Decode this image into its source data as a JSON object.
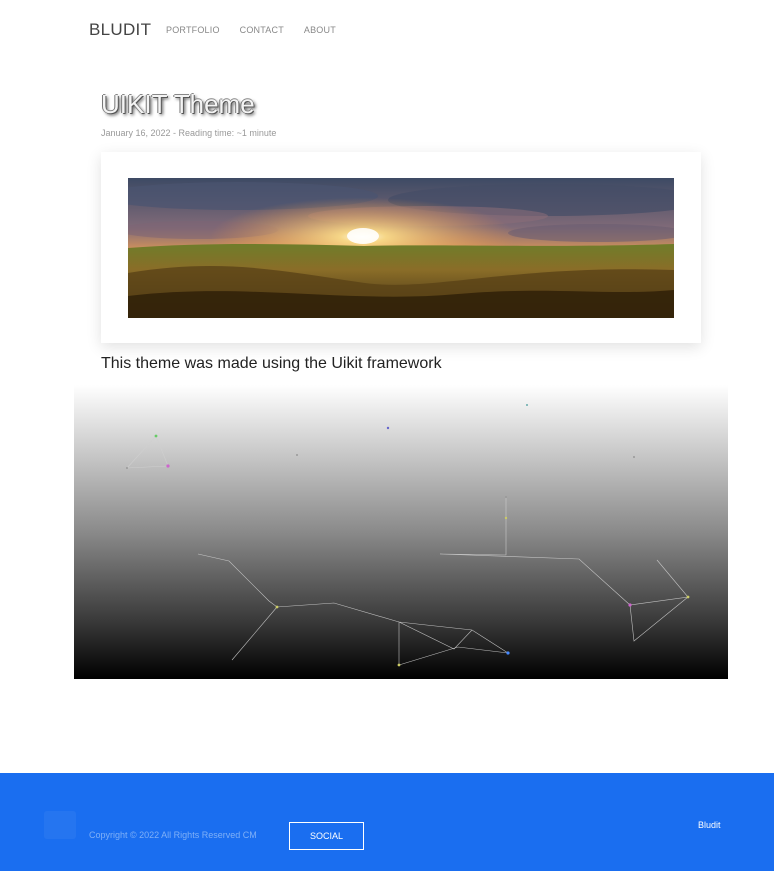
{
  "header": {
    "brand": "BLUDIT",
    "nav": [
      "PORTFOLIO",
      "CONTACT",
      "ABOUT"
    ]
  },
  "post": {
    "title": "UIKIT Theme",
    "meta": "January 16, 2022 - Reading time: ~1 minute",
    "body": "This theme was made using the Uikit framework"
  },
  "footer": {
    "copyright": "Copyright © 2022 All Rights Reserved CM",
    "social_label": "SOCIAL",
    "bludit_link": "Bludit"
  },
  "colors": {
    "footer_bg": "#1a6ef0",
    "accent": "#1a6ef0"
  }
}
